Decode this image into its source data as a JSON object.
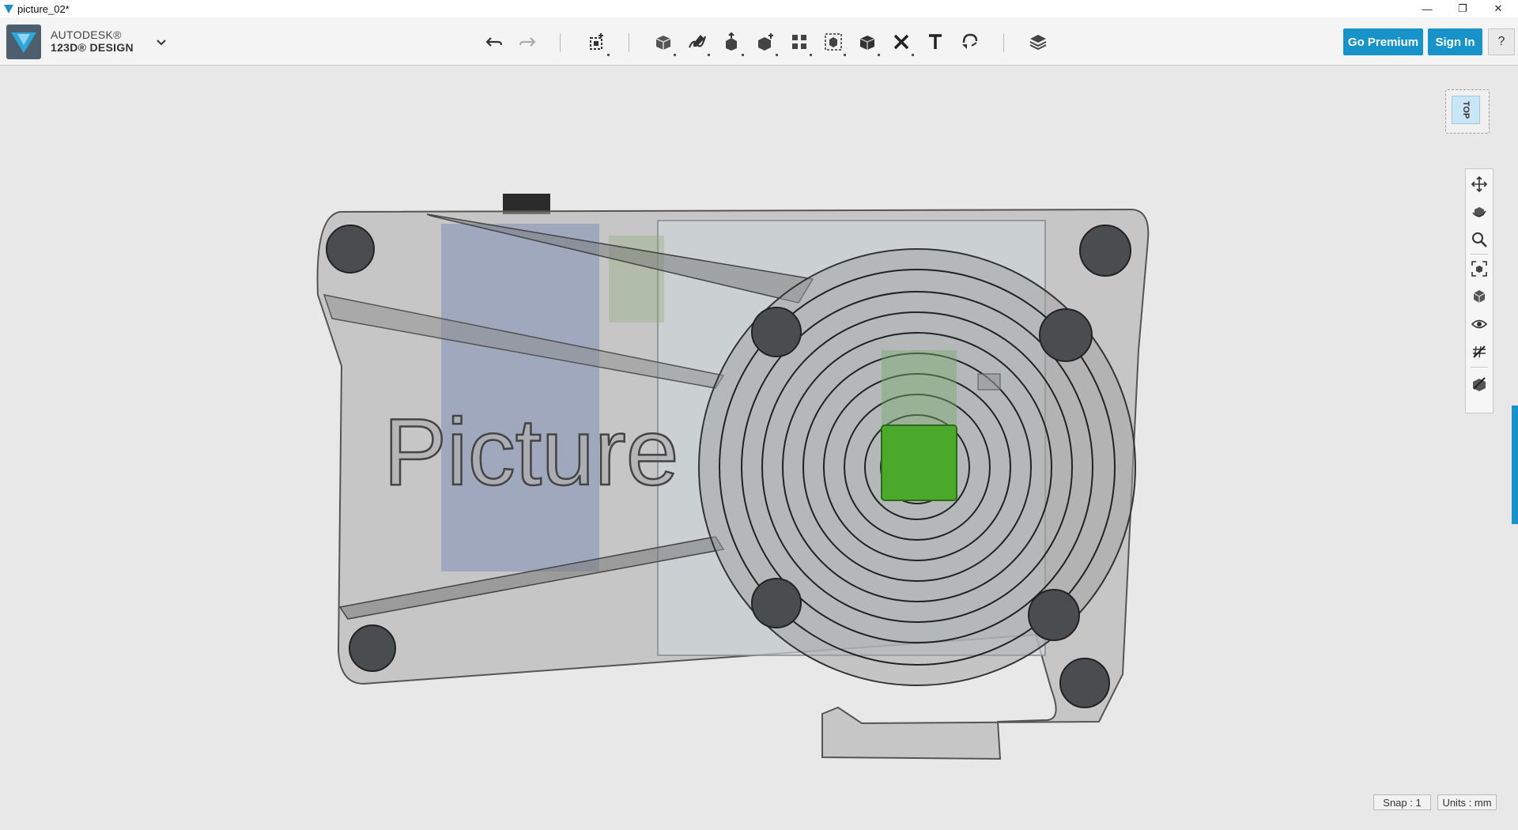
{
  "window": {
    "title": "picture_02*",
    "minimize": "—",
    "restore": "❐",
    "close": "✕"
  },
  "brand": {
    "line1": "AUTODESK®",
    "line2": "123D® DESIGN"
  },
  "toolbar": {
    "tools": [
      {
        "name": "undo-icon"
      },
      {
        "name": "redo-icon"
      },
      {
        "name": "transform-icon"
      },
      {
        "name": "primitives-icon"
      },
      {
        "name": "sketch-icon"
      },
      {
        "name": "construct-icon"
      },
      {
        "name": "modify-icon"
      },
      {
        "name": "pattern-icon"
      },
      {
        "name": "group-icon"
      },
      {
        "name": "combine-icon"
      },
      {
        "name": "measure-icon"
      },
      {
        "name": "text-icon"
      },
      {
        "name": "snap-icon"
      },
      {
        "name": "materials-icon"
      }
    ],
    "go_premium": "Go Premium",
    "sign_in": "Sign In",
    "help": "?"
  },
  "viewport": {
    "viewcube_face": "TOP",
    "model_text": "Picture"
  },
  "navbar": [
    {
      "name": "pan-icon"
    },
    {
      "name": "orbit-icon"
    },
    {
      "name": "zoom-icon"
    },
    {
      "name": "fit-icon"
    },
    {
      "name": "view-mode-icon"
    },
    {
      "name": "visibility-icon"
    },
    {
      "name": "grid-icon"
    },
    {
      "name": "materials-visibility-icon"
    }
  ],
  "status": {
    "snap": "Snap : 1",
    "units": "Units : mm"
  },
  "colors": {
    "accent": "#1893c9",
    "highlight": "#4aa82a"
  }
}
